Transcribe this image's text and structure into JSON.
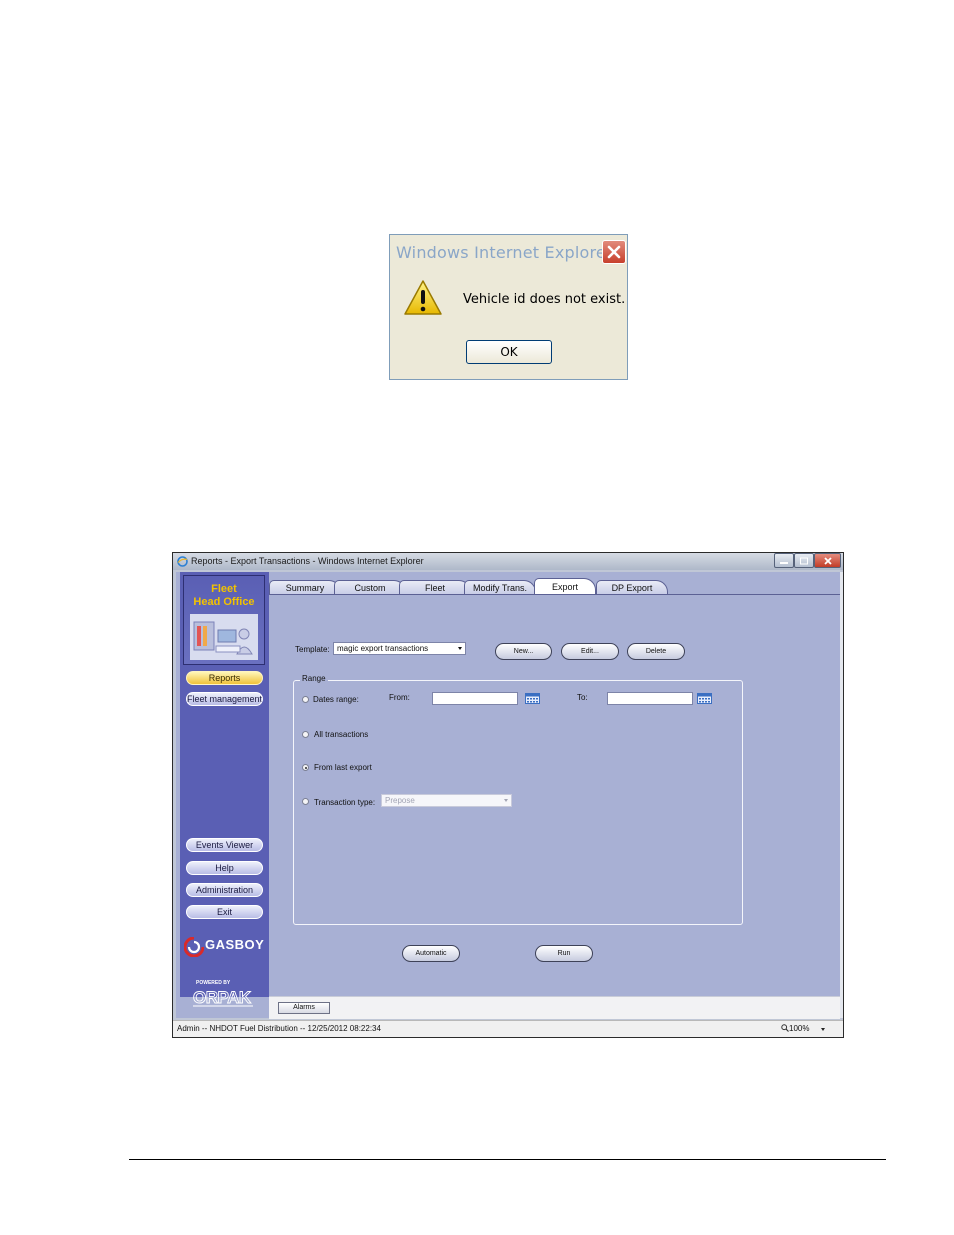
{
  "dialog": {
    "title": "Windows Internet Explorer",
    "message": "Vehicle id does not exist.",
    "ok_label": "OK",
    "icons": {
      "close": "close-icon",
      "warning": "warning-icon"
    }
  },
  "window": {
    "title": "Reports - Export Transactions - Windows Internet Explorer",
    "controls": [
      "minimize-icon",
      "maximize-icon",
      "close-icon"
    ]
  },
  "sidebar": {
    "logo_line1": "Fleet",
    "logo_line2": "Head Office",
    "top_buttons": [
      {
        "label": "Reports",
        "active": true
      },
      {
        "label": "Fleet management",
        "active": false
      }
    ],
    "bottom_buttons": [
      {
        "label": "Events Viewer"
      },
      {
        "label": "Help"
      },
      {
        "label": "Administration"
      },
      {
        "label": "Exit"
      }
    ],
    "brand": "GASBOY",
    "powered_by": "POWERED BY",
    "vendor": "ORPAK"
  },
  "tabs": [
    {
      "label": "Summary",
      "active": false
    },
    {
      "label": "Custom",
      "active": false
    },
    {
      "label": "Fleet",
      "active": false
    },
    {
      "label": "Modify Trans.",
      "active": false
    },
    {
      "label": "Export",
      "active": true
    },
    {
      "label": "DP Export",
      "active": false
    }
  ],
  "export_form": {
    "template_label": "Template:",
    "template_value": "magic export transactions",
    "new_label": "New...",
    "edit_label": "Edit...",
    "delete_label": "Delete",
    "range_legend": "Range",
    "options": {
      "dates_range": "Dates range:",
      "from_label": "From:",
      "to_label": "To:",
      "all_transactions": "All transactions",
      "from_last_export": "From last export",
      "transaction_type": "Transaction type:",
      "transaction_type_value": "Prepose"
    },
    "selected_option": "from_last_export",
    "automatic_label": "Automatic",
    "run_label": "Run"
  },
  "alarms_label": "Alarms",
  "statusbar": {
    "text": "Admin -- NHDOT Fuel Distribution -- 12/25/2012 08:22:34",
    "zoom": "100%"
  },
  "colors": {
    "sidebar": "#5a5fb4",
    "content_bg": "#a8b0d4",
    "active_button": "#f0c23a",
    "logo_text": "#f2c200"
  }
}
